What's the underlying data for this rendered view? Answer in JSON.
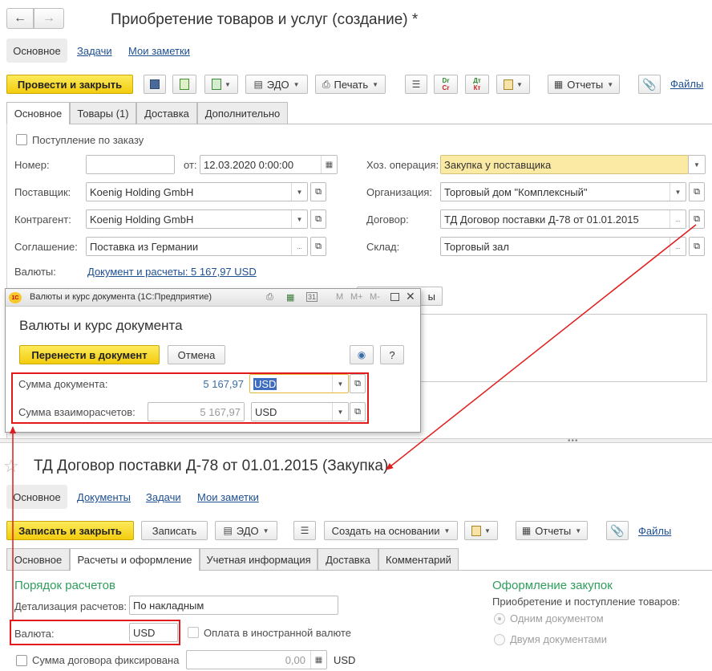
{
  "doc": {
    "title": "Приобретение товаров и услуг (создание) *",
    "nav_tabs": [
      "Основное",
      "Задачи",
      "Мои заметки"
    ],
    "toolbar": {
      "post_close": "Провести и закрыть",
      "edo": "ЭДО",
      "print": "Печать",
      "reports": "Отчеты",
      "files": "Файлы"
    },
    "tabs": [
      "Основное",
      "Товары (1)",
      "Доставка",
      "Дополнительно"
    ],
    "by_order": "Поступление по заказу",
    "number_label": "Номер:",
    "number_value": "",
    "date_label": "от:",
    "date_value": "12.03.2020  0:00:00",
    "supplier_label": "Поставщик:",
    "supplier_value": "Koenig Holding GmbH",
    "counterparty_label": "Контрагент:",
    "counterparty_value": "Koenig Holding GmbH",
    "agreement_label": "Соглашение:",
    "agreement_value": "Поставка из Германии",
    "currencies_label": "Валюты:",
    "currencies_link": "Документ и расчеты: 5 167,97 USD",
    "operation_label": "Хоз. операция:",
    "operation_value": "Закупка у поставщика",
    "org_label": "Организация:",
    "org_value": "Торговый дом \"Комплексный\"",
    "contract_label": "Договор:",
    "contract_value": "ТД Договор поставки Д-78 от 01.01.2015",
    "warehouse_label": "Склад:",
    "warehouse_value": "Торговый зал",
    "hidden_button_tail": "ы"
  },
  "popup": {
    "titlebar": "Валюты и курс документа  (1С:Предприятие)",
    "titlebar_tools": [
      "M",
      "M+",
      "M-"
    ],
    "heading": "Валюты и курс документа",
    "transfer": "Перенести в документ",
    "cancel": "Отмена",
    "help": "?",
    "doc_sum_label": "Сумма документа:",
    "doc_sum_value": "5 167,97",
    "doc_currency": "USD",
    "settle_sum_label": "Сумма взаиморасчетов:",
    "settle_sum_value": "5 167,97",
    "settle_currency": "USD"
  },
  "contract": {
    "title": "ТД Договор поставки Д-78 от 01.01.2015 (Закупка)",
    "nav_tabs": [
      "Основное",
      "Документы",
      "Задачи",
      "Мои заметки"
    ],
    "toolbar": {
      "save_close": "Записать и закрыть",
      "save": "Записать",
      "edo": "ЭДО",
      "create_based": "Создать на основании",
      "reports": "Отчеты",
      "files": "Файлы"
    },
    "tabs": [
      "Основное",
      "Расчеты и оформление",
      "Учетная информация",
      "Доставка",
      "Комментарий"
    ],
    "settlement_heading": "Порядок расчетов",
    "detail_label": "Детализация расчетов:",
    "detail_value": "По накладным",
    "currency_label": "Валюта:",
    "currency_value": "USD",
    "foreign_pay": "Оплата в иностранной валюте",
    "fixed_sum": "Сумма договора фиксирована",
    "fixed_sum_value": "0,00",
    "fixed_sum_currency": "USD",
    "purchase_heading": "Оформление закупок",
    "purchase_sub": "Приобретение и поступление товаров:",
    "radio_one": "Одним документом",
    "radio_two": "Двумя документами"
  },
  "colors": {
    "accent_green": "#2f9e5c",
    "highlight_red": "#e11b1b",
    "link_blue": "#1d4f91",
    "yellow_button": "#f5d21c"
  }
}
